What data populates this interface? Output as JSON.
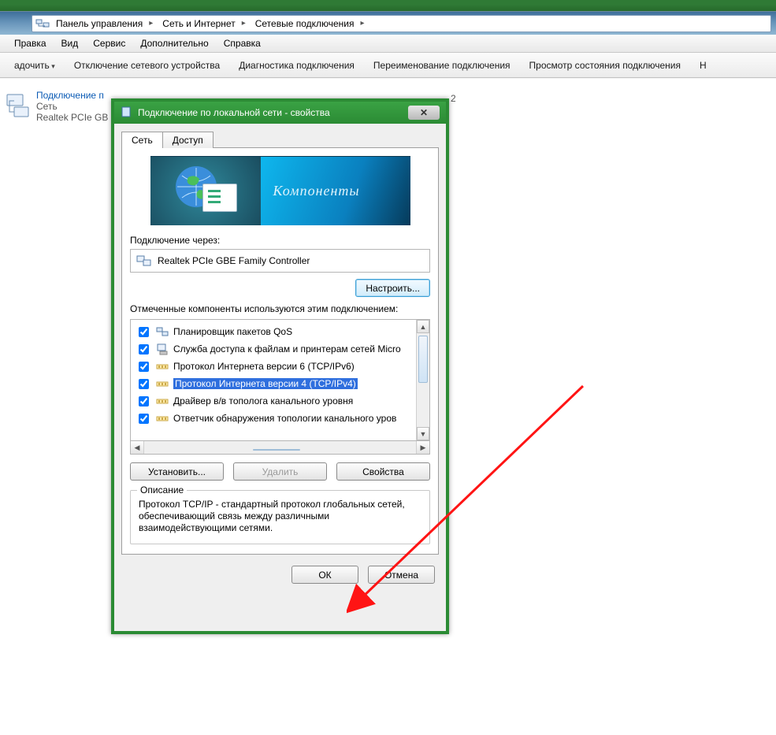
{
  "breadcrumb": {
    "items": [
      "Панель управления",
      "Сеть и Интернет",
      "Сетевые подключения"
    ]
  },
  "menu": {
    "items": [
      "Правка",
      "Вид",
      "Сервис",
      "Дополнительно",
      "Справка"
    ]
  },
  "toolbar": {
    "items": [
      "адочить",
      "Отключение сетевого устройства",
      "Диагностика подключения",
      "Переименование подключения",
      "Просмотр состояния подключения",
      "Н"
    ]
  },
  "content": {
    "conn1": {
      "title": "Подключение п",
      "sub1": "Сеть",
      "sub2": "Realtek PCIe GB"
    },
    "conn2_fragment": "2"
  },
  "dialog": {
    "title": "Подключение по локальной сети - свойства",
    "tabs": {
      "net": "Сеть",
      "access": "Доступ"
    },
    "banner_text": "Компоненты",
    "connect_via_label": "Подключение через:",
    "adapter": "Realtek PCIe GBE Family Controller",
    "configure_btn": "Настроить...",
    "components_label": "Отмеченные компоненты используются этим подключением:",
    "components": [
      {
        "label": "Планировщик пакетов QoS",
        "checked": true,
        "selected": false,
        "icon": "net"
      },
      {
        "label": "Служба доступа к файлам и принтерам сетей Micro",
        "checked": true,
        "selected": false,
        "icon": "share"
      },
      {
        "label": "Протокол Интернета версии 6 (TCP/IPv6)",
        "checked": true,
        "selected": false,
        "icon": "proto"
      },
      {
        "label": "Протокол Интернета версии 4 (TCP/IPv4)",
        "checked": true,
        "selected": true,
        "icon": "proto"
      },
      {
        "label": "Драйвер в/в тополога канального уровня",
        "checked": true,
        "selected": false,
        "icon": "proto"
      },
      {
        "label": "Ответчик обнаружения топологии канального уров",
        "checked": true,
        "selected": false,
        "icon": "proto"
      }
    ],
    "install_btn": "Установить...",
    "remove_btn": "Удалить",
    "props_btn": "Свойства",
    "desc_legend": "Описание",
    "desc_text": "Протокол TCP/IP - стандартный протокол глобальных сетей, обеспечивающий связь между различными взаимодействующими сетями.",
    "ok_btn": "ОК",
    "cancel_btn": "Отмена"
  }
}
